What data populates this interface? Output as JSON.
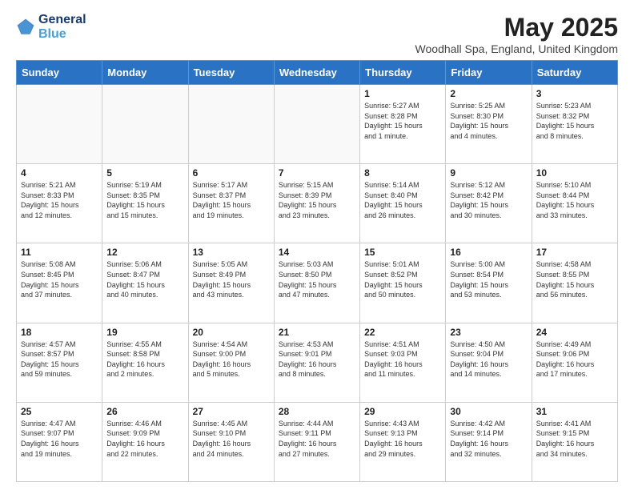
{
  "header": {
    "logo_line1": "General",
    "logo_line2": "Blue",
    "month_title": "May 2025",
    "location": "Woodhall Spa, England, United Kingdom"
  },
  "days_of_week": [
    "Sunday",
    "Monday",
    "Tuesday",
    "Wednesday",
    "Thursday",
    "Friday",
    "Saturday"
  ],
  "weeks": [
    [
      {
        "day": "",
        "info": ""
      },
      {
        "day": "",
        "info": ""
      },
      {
        "day": "",
        "info": ""
      },
      {
        "day": "",
        "info": ""
      },
      {
        "day": "1",
        "info": "Sunrise: 5:27 AM\nSunset: 8:28 PM\nDaylight: 15 hours\nand 1 minute."
      },
      {
        "day": "2",
        "info": "Sunrise: 5:25 AM\nSunset: 8:30 PM\nDaylight: 15 hours\nand 4 minutes."
      },
      {
        "day": "3",
        "info": "Sunrise: 5:23 AM\nSunset: 8:32 PM\nDaylight: 15 hours\nand 8 minutes."
      }
    ],
    [
      {
        "day": "4",
        "info": "Sunrise: 5:21 AM\nSunset: 8:33 PM\nDaylight: 15 hours\nand 12 minutes."
      },
      {
        "day": "5",
        "info": "Sunrise: 5:19 AM\nSunset: 8:35 PM\nDaylight: 15 hours\nand 15 minutes."
      },
      {
        "day": "6",
        "info": "Sunrise: 5:17 AM\nSunset: 8:37 PM\nDaylight: 15 hours\nand 19 minutes."
      },
      {
        "day": "7",
        "info": "Sunrise: 5:15 AM\nSunset: 8:39 PM\nDaylight: 15 hours\nand 23 minutes."
      },
      {
        "day": "8",
        "info": "Sunrise: 5:14 AM\nSunset: 8:40 PM\nDaylight: 15 hours\nand 26 minutes."
      },
      {
        "day": "9",
        "info": "Sunrise: 5:12 AM\nSunset: 8:42 PM\nDaylight: 15 hours\nand 30 minutes."
      },
      {
        "day": "10",
        "info": "Sunrise: 5:10 AM\nSunset: 8:44 PM\nDaylight: 15 hours\nand 33 minutes."
      }
    ],
    [
      {
        "day": "11",
        "info": "Sunrise: 5:08 AM\nSunset: 8:45 PM\nDaylight: 15 hours\nand 37 minutes."
      },
      {
        "day": "12",
        "info": "Sunrise: 5:06 AM\nSunset: 8:47 PM\nDaylight: 15 hours\nand 40 minutes."
      },
      {
        "day": "13",
        "info": "Sunrise: 5:05 AM\nSunset: 8:49 PM\nDaylight: 15 hours\nand 43 minutes."
      },
      {
        "day": "14",
        "info": "Sunrise: 5:03 AM\nSunset: 8:50 PM\nDaylight: 15 hours\nand 47 minutes."
      },
      {
        "day": "15",
        "info": "Sunrise: 5:01 AM\nSunset: 8:52 PM\nDaylight: 15 hours\nand 50 minutes."
      },
      {
        "day": "16",
        "info": "Sunrise: 5:00 AM\nSunset: 8:54 PM\nDaylight: 15 hours\nand 53 minutes."
      },
      {
        "day": "17",
        "info": "Sunrise: 4:58 AM\nSunset: 8:55 PM\nDaylight: 15 hours\nand 56 minutes."
      }
    ],
    [
      {
        "day": "18",
        "info": "Sunrise: 4:57 AM\nSunset: 8:57 PM\nDaylight: 15 hours\nand 59 minutes."
      },
      {
        "day": "19",
        "info": "Sunrise: 4:55 AM\nSunset: 8:58 PM\nDaylight: 16 hours\nand 2 minutes."
      },
      {
        "day": "20",
        "info": "Sunrise: 4:54 AM\nSunset: 9:00 PM\nDaylight: 16 hours\nand 5 minutes."
      },
      {
        "day": "21",
        "info": "Sunrise: 4:53 AM\nSunset: 9:01 PM\nDaylight: 16 hours\nand 8 minutes."
      },
      {
        "day": "22",
        "info": "Sunrise: 4:51 AM\nSunset: 9:03 PM\nDaylight: 16 hours\nand 11 minutes."
      },
      {
        "day": "23",
        "info": "Sunrise: 4:50 AM\nSunset: 9:04 PM\nDaylight: 16 hours\nand 14 minutes."
      },
      {
        "day": "24",
        "info": "Sunrise: 4:49 AM\nSunset: 9:06 PM\nDaylight: 16 hours\nand 17 minutes."
      }
    ],
    [
      {
        "day": "25",
        "info": "Sunrise: 4:47 AM\nSunset: 9:07 PM\nDaylight: 16 hours\nand 19 minutes."
      },
      {
        "day": "26",
        "info": "Sunrise: 4:46 AM\nSunset: 9:09 PM\nDaylight: 16 hours\nand 22 minutes."
      },
      {
        "day": "27",
        "info": "Sunrise: 4:45 AM\nSunset: 9:10 PM\nDaylight: 16 hours\nand 24 minutes."
      },
      {
        "day": "28",
        "info": "Sunrise: 4:44 AM\nSunset: 9:11 PM\nDaylight: 16 hours\nand 27 minutes."
      },
      {
        "day": "29",
        "info": "Sunrise: 4:43 AM\nSunset: 9:13 PM\nDaylight: 16 hours\nand 29 minutes."
      },
      {
        "day": "30",
        "info": "Sunrise: 4:42 AM\nSunset: 9:14 PM\nDaylight: 16 hours\nand 32 minutes."
      },
      {
        "day": "31",
        "info": "Sunrise: 4:41 AM\nSunset: 9:15 PM\nDaylight: 16 hours\nand 34 minutes."
      }
    ]
  ]
}
